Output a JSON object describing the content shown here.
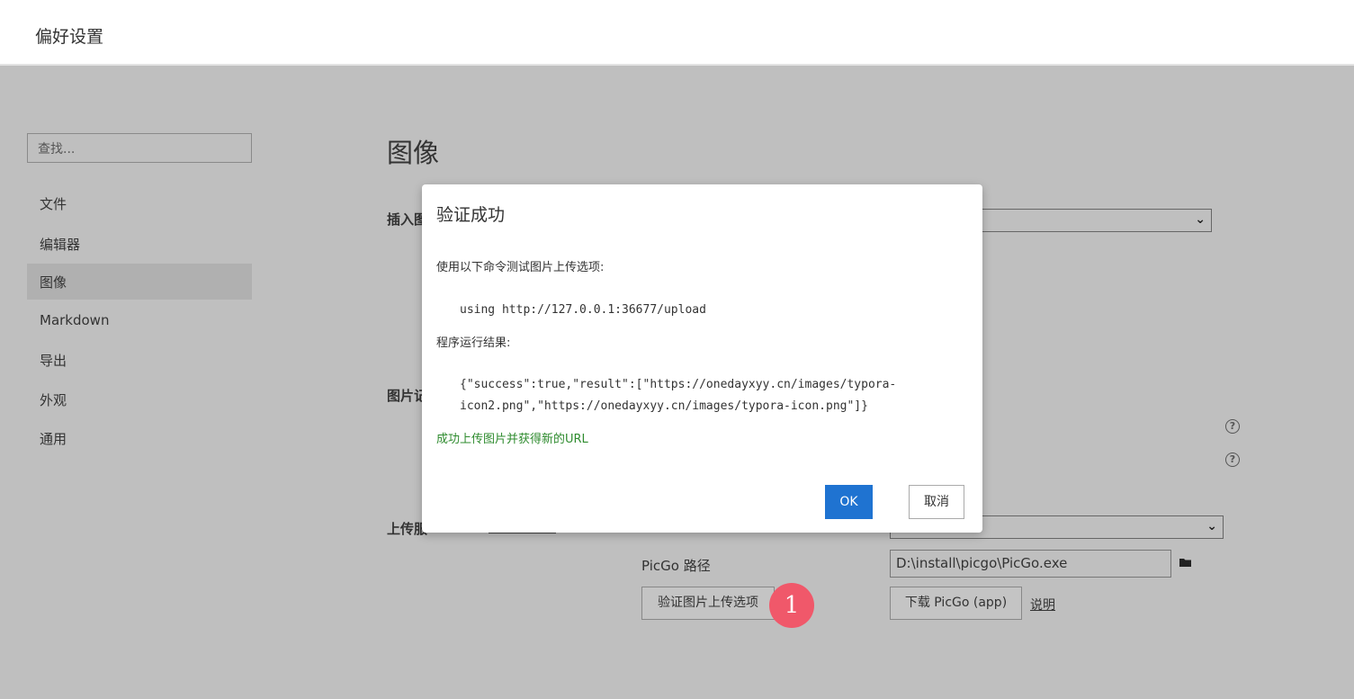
{
  "window": {
    "title": "偏好设置"
  },
  "sidebar": {
    "search_placeholder": "查找...",
    "items": [
      {
        "label": "文件"
      },
      {
        "label": "编辑器"
      },
      {
        "label": "图像",
        "active": true
      },
      {
        "label": "Markdown"
      },
      {
        "label": "导出"
      },
      {
        "label": "外观"
      },
      {
        "label": "通用"
      }
    ]
  },
  "main": {
    "heading": "图像",
    "insert_label": "插入图",
    "image_section_label": "图片记",
    "upload_service_label": "上传服",
    "picgo_path_label": "PicGo 路径",
    "picgo_path_value": "D:\\install\\picgo\\PicGo.exe",
    "verify_button": "验证图片上传选项",
    "download_button": "下载 PicGo (app)",
    "help_link": "说明"
  },
  "annotation": {
    "badge_number": "1",
    "badge_color": "#f0586a"
  },
  "dialog": {
    "title": "验证成功",
    "intro": "使用以下命令测试图片上传选项:",
    "command": "using http://127.0.0.1:36677/upload",
    "result_label": "程序运行结果:",
    "result_line1": "{\"success\":true,\"result\":[\"https://onedayxyy.cn/images/typora-",
    "result_line2": "icon2.png\",\"https://onedayxyy.cn/images/typora-icon.png\"]}",
    "success_message": "成功上传图片并获得新的URL",
    "ok_label": "OK",
    "cancel_label": "取消",
    "ok_color": "#1f73d1",
    "success_color": "#2e8b2e"
  }
}
